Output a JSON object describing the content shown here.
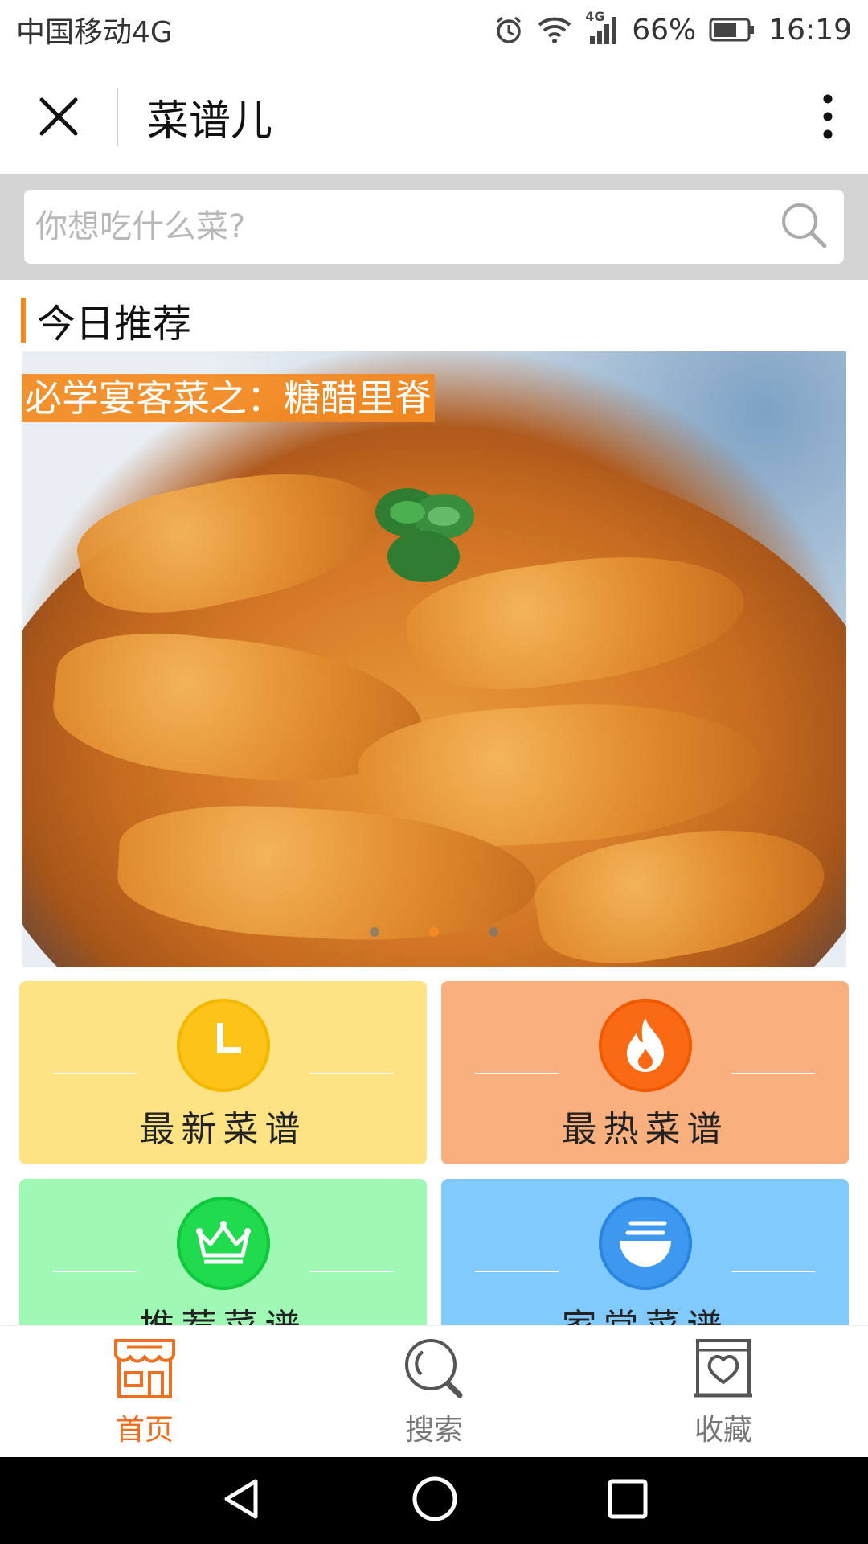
{
  "status_bar": {
    "carrier": "中国移动4G",
    "network_badge": "4G",
    "battery": "66%",
    "time": "16:19"
  },
  "title_bar": {
    "title": "菜谱儿"
  },
  "search": {
    "placeholder": "你想吃什么菜?"
  },
  "section": {
    "title": "今日推荐"
  },
  "banner": {
    "caption": "必学宴客菜之：糖醋里脊",
    "slide_count": 3,
    "active_slide": 2
  },
  "categories": [
    {
      "label": "最新菜谱",
      "bg": "#fde384",
      "icon_bg": "#fcc419",
      "icon": "clock-icon"
    },
    {
      "label": "最热菜谱",
      "bg": "#fab07e",
      "icon_bg": "#fa6a14",
      "icon": "flame-icon"
    },
    {
      "label": "推荐菜谱",
      "bg": "#9ff9b5",
      "icon_bg": "#20db4e",
      "icon": "crown-icon"
    },
    {
      "label": "家常菜谱",
      "bg": "#80caff",
      "icon_bg": "#3d99f0",
      "icon": "bowl-icon"
    }
  ],
  "bottom_nav": {
    "items": [
      {
        "label": "首页",
        "icon": "store-icon",
        "active": true
      },
      {
        "label": "搜索",
        "icon": "search-icon",
        "active": false
      },
      {
        "label": "收藏",
        "icon": "heart-folder-icon",
        "active": false
      }
    ]
  },
  "colors": {
    "accent": "#f4891e",
    "active_nav": "#f06f1f"
  }
}
